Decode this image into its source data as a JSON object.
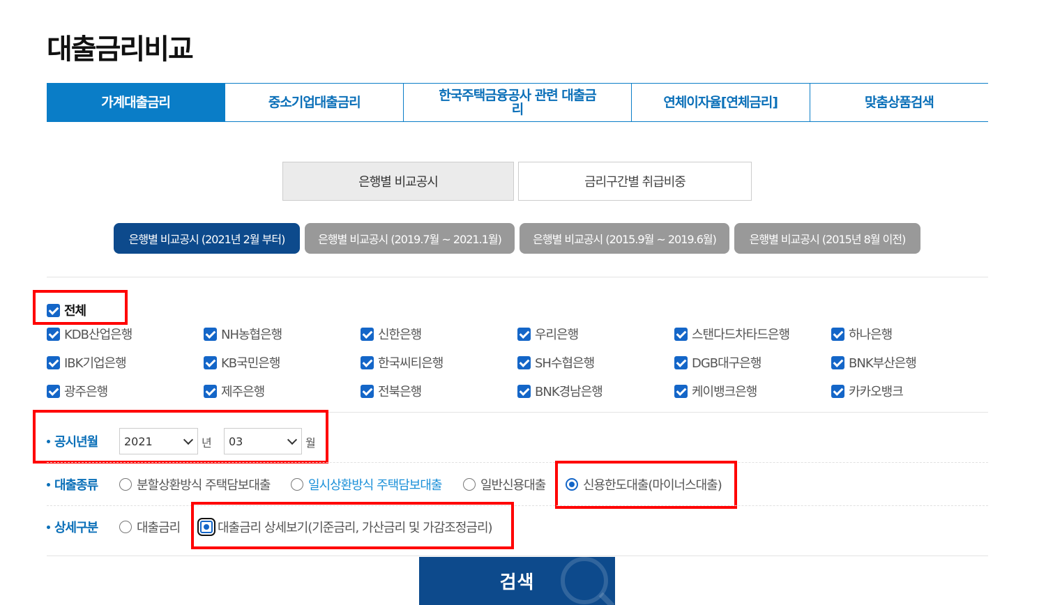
{
  "page_title": "대출금리비교",
  "main_tabs": [
    {
      "label": "가계대출금리",
      "active": true
    },
    {
      "label": "중소기업대출금리",
      "active": false
    },
    {
      "label": "한국주택금융공사 관련 대출금리",
      "active": false
    },
    {
      "label": "연체이자율[연체금리]",
      "active": false
    },
    {
      "label": "맞춤상품검색",
      "active": false
    }
  ],
  "sub_tabs": [
    {
      "label": "은행별 비교공시",
      "active": true
    },
    {
      "label": "금리구간별 취급비중",
      "active": false
    }
  ],
  "period_buttons": [
    {
      "label": "은행별 비교공시 (2021년 2월 부터)",
      "active": true
    },
    {
      "label": "은행별 비교공시 (2019.7월 ~ 2021.1월)",
      "active": false
    },
    {
      "label": "은행별 비교공시 (2015.9월 ~ 2019.6월)",
      "active": false
    },
    {
      "label": "은행별 비교공시 (2015년 8월 이전)",
      "active": false
    }
  ],
  "all_checkbox": {
    "label": "전체",
    "checked": true
  },
  "banks": [
    [
      "KDB산업은행",
      "NH농협은행",
      "신한은행",
      "우리은행",
      "스탠다드차타드은행",
      "하나은행"
    ],
    [
      "IBK기업은행",
      "KB국민은행",
      "한국씨티은행",
      "SH수협은행",
      "DGB대구은행",
      "BNK부산은행"
    ],
    [
      "광주은행",
      "제주은행",
      "전북은행",
      "BNK경남은행",
      "케이뱅크은행",
      "카카오뱅크"
    ]
  ],
  "disclosure": {
    "label": "공시년월",
    "year_value": "2021",
    "year_unit": "년",
    "month_value": "03",
    "month_unit": "월"
  },
  "loan_type": {
    "label": "대출종류",
    "options": [
      {
        "label": "분할상환방식 주택담보대출",
        "selected": false
      },
      {
        "label": "일시상환방식 주택담보대출",
        "selected": false
      },
      {
        "label": "일반신용대출",
        "selected": false
      },
      {
        "label": "신용한도대출(마이너스대출)",
        "selected": true
      }
    ]
  },
  "detail_type": {
    "label": "상세구분",
    "options": [
      {
        "label": "대출금리",
        "selected": false
      },
      {
        "label": "대출금리 상세보기(기준금리, 가산금리 및 가감조정금리)",
        "selected": true
      }
    ]
  },
  "search_button": "검색",
  "colors": {
    "primary": "#0a7dc7",
    "dark_blue": "#0d4a8c",
    "highlight": "#ff0000",
    "gray_pill": "#999999"
  },
  "icons": [
    "checkbox-checked-icon",
    "radio-icon",
    "chevron-down-icon",
    "magnifier-icon"
  ]
}
